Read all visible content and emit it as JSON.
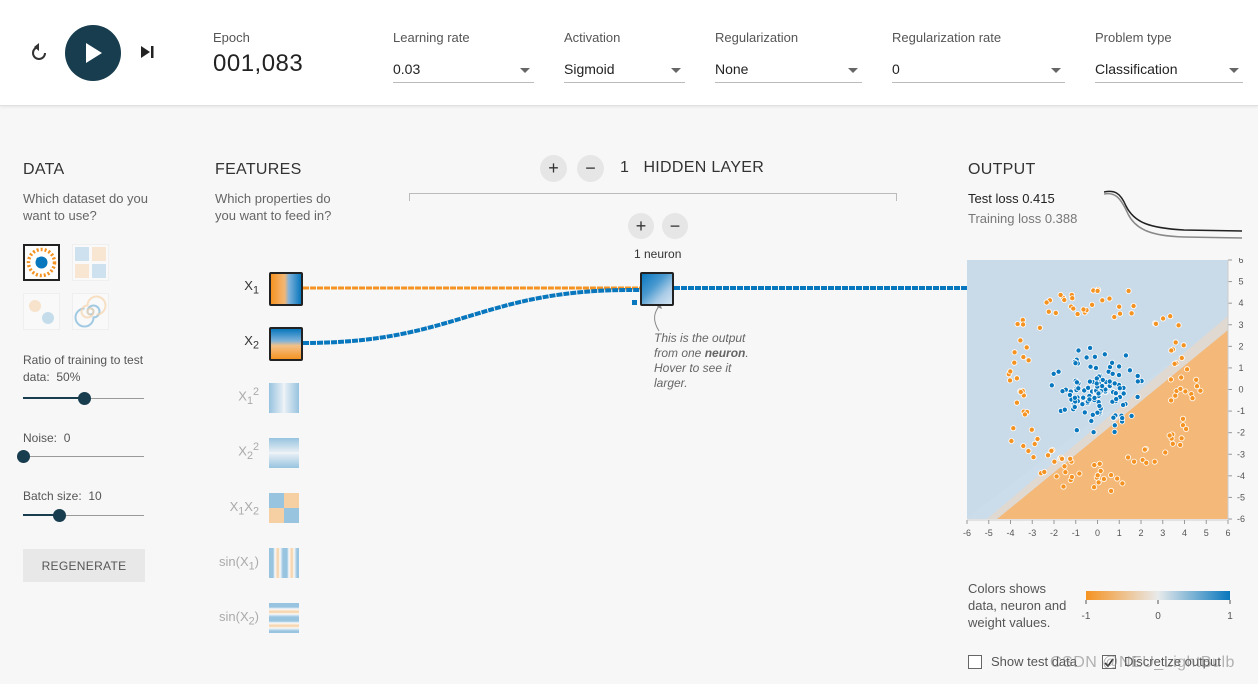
{
  "toolbar": {
    "reset_icon": "reset-icon",
    "play_icon": "play-icon",
    "step_icon": "step-forward-icon",
    "epoch_label": "Epoch",
    "epoch_value": "001,083",
    "learning_rate": {
      "label": "Learning rate",
      "value": "0.03"
    },
    "activation": {
      "label": "Activation",
      "value": "Sigmoid"
    },
    "regularization": {
      "label": "Regularization",
      "value": "None"
    },
    "regularization_rate": {
      "label": "Regularization rate",
      "value": "0"
    },
    "problem_type": {
      "label": "Problem type",
      "value": "Classification"
    }
  },
  "data_panel": {
    "title": "DATA",
    "subtitle": "Which dataset do you want to use?",
    "datasets": [
      "circle-dataset-icon",
      "xor-dataset-icon",
      "gaussian-dataset-icon",
      "spiral-dataset-icon"
    ],
    "selected_dataset": 0,
    "ratio_label": "Ratio of training to test data:",
    "ratio_value": "50%",
    "ratio_fraction": 0.5,
    "noise_label": "Noise:",
    "noise_value": "0",
    "noise_fraction": 0,
    "batch_label": "Batch size:",
    "batch_value": "10",
    "batch_fraction": 0.3,
    "regenerate_label": "REGENERATE"
  },
  "features_panel": {
    "title": "FEATURES",
    "subtitle": "Which properties do you want to feed in?",
    "features": [
      {
        "base": "X",
        "sub": "1",
        "sup": "",
        "active": true
      },
      {
        "base": "X",
        "sub": "2",
        "sup": "",
        "active": true
      },
      {
        "base": "X",
        "sub": "1",
        "sup": "2",
        "active": false
      },
      {
        "base": "X",
        "sub": "2",
        "sup": "2",
        "active": false
      },
      {
        "base": "X",
        "sub": "1",
        "base2": "X",
        "sub2": "2",
        "active": false
      },
      {
        "base": "sin(X",
        "sub": "1",
        "tail": ")",
        "active": false
      },
      {
        "base": "sin(X",
        "sub": "2",
        "tail": ")",
        "active": false
      }
    ]
  },
  "network": {
    "layer_count": "1",
    "hidden_title": "HIDDEN LAYER",
    "add_layer": "+",
    "remove_layer": "−",
    "add_neuron": "+",
    "remove_neuron": "−",
    "neuron_count": "1 neuron",
    "callout_pre": "This is the output from one ",
    "callout_bold": "neuron",
    "callout_post": ". Hover to see it larger."
  },
  "output_panel": {
    "title": "OUTPUT",
    "test_loss_label": "Test loss",
    "test_loss": "0.415",
    "training_loss_label": "Training loss",
    "training_loss": "0.388",
    "axis_ticks": [
      "-6",
      "-5",
      "-4",
      "-3",
      "-2",
      "-1",
      "0",
      "1",
      "2",
      "3",
      "4",
      "5",
      "6"
    ],
    "legend_text": "Colors shows data, neuron and weight values.",
    "legend_ticks": [
      "-1",
      "0",
      "1"
    ],
    "show_test_data_label": "Show test data",
    "show_test_data": false,
    "discretize_label": "Discretize output",
    "discretize": true
  },
  "colors": {
    "positive": "#0877bd",
    "negative": "#f59322",
    "accent": "#183d4e"
  },
  "watermark": "CSDN @NEU_LightBulb"
}
